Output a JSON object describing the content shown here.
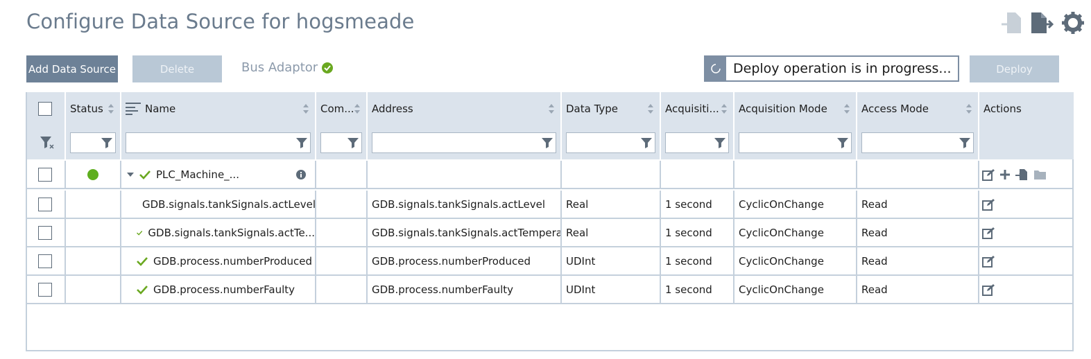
{
  "page": {
    "title": "Configure Data Source for hogsmeade"
  },
  "toolbar": {
    "add_label": "Add Data Source",
    "delete_label": "Delete",
    "bus_adaptor_label": "Bus Adaptor",
    "progress_text": "Deploy operation is in progress...",
    "deploy_label": "Deploy"
  },
  "columns": [
    "Status",
    "Name",
    "Com...",
    "Address",
    "Data Type",
    "Acquisiti...",
    "Acquisition Mode",
    "Access Mode",
    "Actions"
  ],
  "rows": [
    {
      "name": "PLC_Machine_...",
      "address": "",
      "data_type": "",
      "acq": "",
      "acq_mode": "",
      "access": ""
    },
    {
      "name": "GDB.signals.tankSignals.actLevel",
      "address": "GDB.signals.tankSignals.actLevel",
      "data_type": "Real",
      "acq": "1 second",
      "acq_mode": "CyclicOnChange",
      "access": "Read"
    },
    {
      "name": "GDB.signals.tankSignals.actTe...",
      "address": "GDB.signals.tankSignals.actTempera...",
      "data_type": "Real",
      "acq": "1 second",
      "acq_mode": "CyclicOnChange",
      "access": "Read"
    },
    {
      "name": "GDB.process.numberProduced",
      "address": "GDB.process.numberProduced",
      "data_type": "UDInt",
      "acq": "1 second",
      "acq_mode": "CyclicOnChange",
      "access": "Read"
    },
    {
      "name": "GDB.process.numberFaulty",
      "address": "GDB.process.numberFaulty",
      "data_type": "UDInt",
      "acq": "1 second",
      "acq_mode": "CyclicOnChange",
      "access": "Read"
    }
  ],
  "colors": {
    "accent": "#6d8197",
    "check_green": "#6aa820",
    "status_green": "#5eae1e",
    "header_bg": "#dbe3ec"
  },
  "icons": [
    "import-icon",
    "export-icon",
    "gear-icon",
    "filter-icon",
    "sort-icon",
    "info-icon",
    "edit-icon",
    "plus-icon",
    "folder-icon",
    "spinner-icon",
    "clear-filter-icon"
  ]
}
